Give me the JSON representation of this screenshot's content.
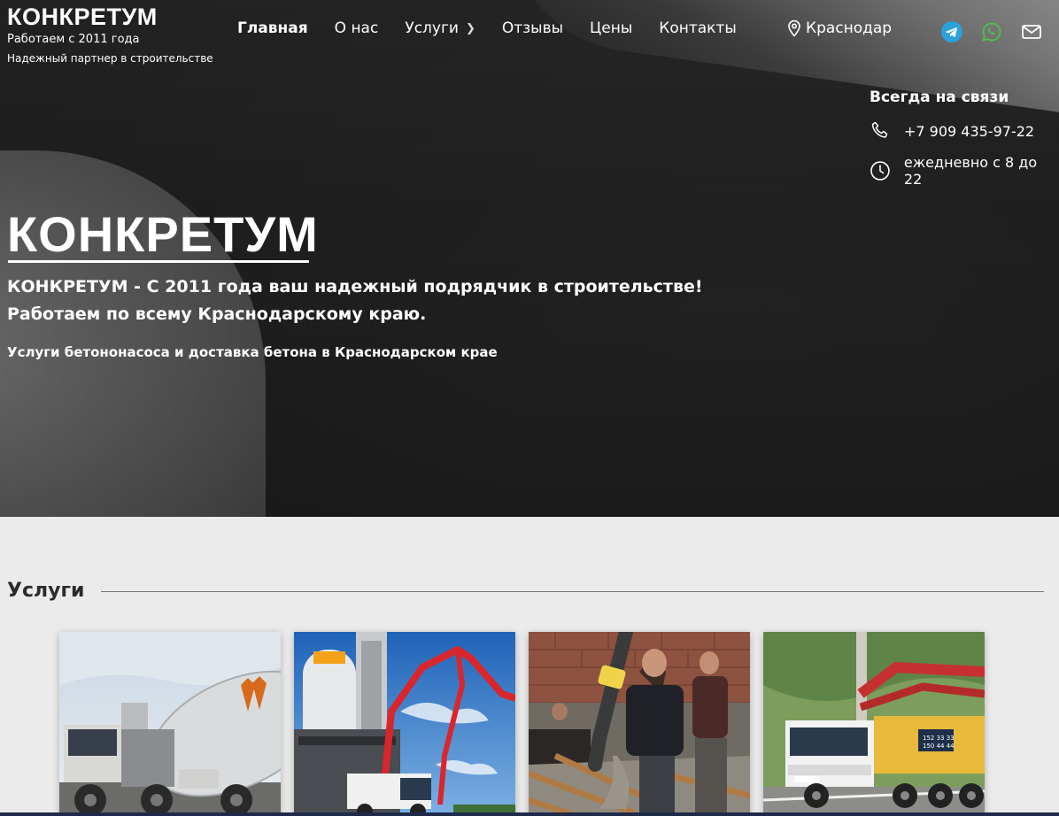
{
  "header": {
    "logo_name": "КОНКРЕТУМ",
    "logo_sub1": "Работаем с 2011 года",
    "logo_sub2": "Надежный партнер в строительстве",
    "nav": [
      {
        "label": "Главная",
        "active": true
      },
      {
        "label": "О нас"
      },
      {
        "label": "Услуги",
        "has_submenu": true
      },
      {
        "label": "Отзывы"
      },
      {
        "label": "Цены"
      },
      {
        "label": "Контакты"
      }
    ],
    "city": "Краснодар",
    "socials": [
      "telegram-icon",
      "whatsapp-icon",
      "mail-icon"
    ],
    "colors": {
      "telegram": "#2aa1da",
      "whatsapp": "#4ec24e"
    }
  },
  "contacts": {
    "title": "Всегда на связи",
    "phone": "+7 909 435-97-22",
    "hours": "ежедневно с 8 до 22"
  },
  "hero": {
    "title": "КОНКРЕТУМ",
    "description": "КОНКРЕТУМ - С 2011 года ваш надежный подрядчик в строительстве! Работаем по всему Краснодарскому краю.",
    "note": "Услуги бетононасоса и доставка бетона в Краснодарском крае"
  },
  "services": {
    "title": "Услуги",
    "cards": [
      {
        "image": "concrete-mixer-truck-photo"
      },
      {
        "image": "concrete-pump-plant-photo"
      },
      {
        "image": "workers-pouring-concrete-photo"
      },
      {
        "image": "concrete-pump-truck-photo"
      }
    ]
  }
}
